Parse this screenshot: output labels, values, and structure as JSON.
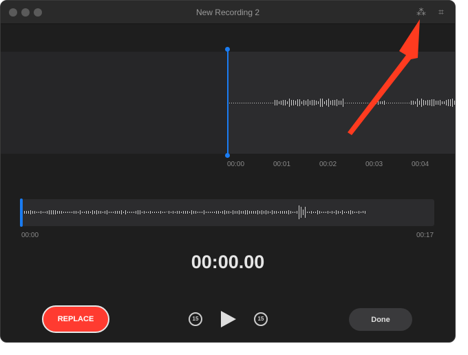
{
  "window": {
    "title": "New Recording 2"
  },
  "toolbar": {
    "enhance_icon": "enhance-sparkle-icon",
    "trim_icon": "crop-trim-icon"
  },
  "timeline": {
    "ticks": [
      "00:00",
      "00:01",
      "00:02",
      "00:03",
      "00:04"
    ]
  },
  "overview": {
    "start": "00:00",
    "end": "00:17",
    "position_fraction": 0
  },
  "playback": {
    "time": "00:00.00",
    "skip_back": "15",
    "skip_forward": "15"
  },
  "buttons": {
    "replace": "REPLACE",
    "done": "Done"
  },
  "colors": {
    "accent": "#1a7cf2",
    "replace": "#ff3b30",
    "annotation_arrow": "#ff3b1f"
  }
}
